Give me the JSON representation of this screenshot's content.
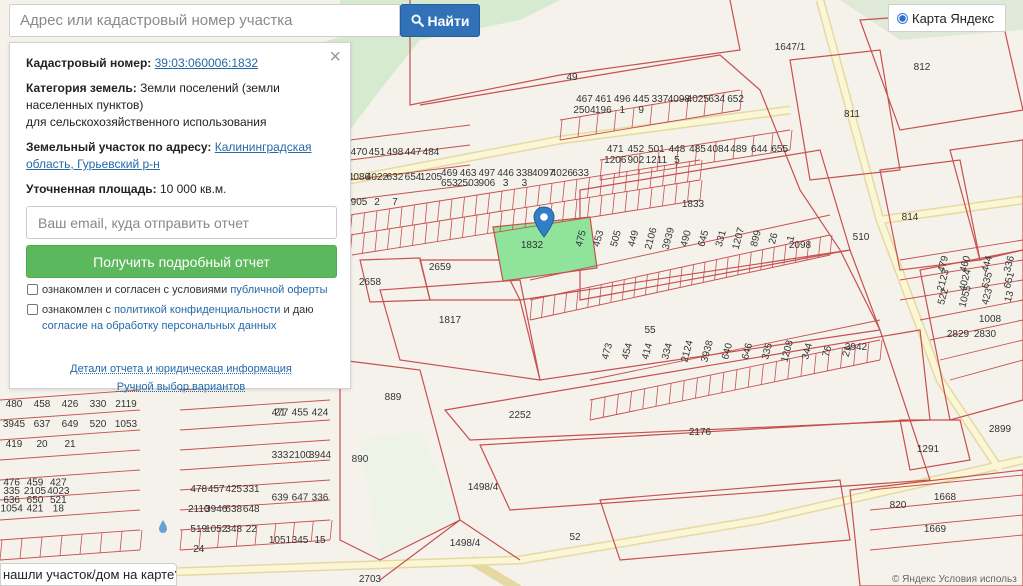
{
  "search": {
    "placeholder": "Адрес или кадастровый номер участка",
    "button_label": "Найти"
  },
  "layer_switch": {
    "label": "Карта Яндекс"
  },
  "info": {
    "cadastral_label": "Кадастровый номер:",
    "cadastral_value": "39:03:060006:1832",
    "category_label": "Категория земель:",
    "category_value_l1": "Земли поселений (земли",
    "category_value_l2": "населенных пунктов)",
    "category_value_l3": "для сельскохозяйственного использования",
    "address_label": "Земельный участок по адресу:",
    "address_value_l1": "Калининградская",
    "address_value_l2": "область, Гурьевский р-н",
    "area_label": "Уточненная площадь:",
    "area_value": "10 000 кв.м.",
    "email_placeholder": "Ваш email, куда отправить отчет",
    "get_report": "Получить подробный отчет",
    "consent1_text": "ознакомлен и согласен с условиями ",
    "consent1_link": "публичной оферты",
    "consent2_text_a": "ознакомлен с ",
    "consent2_link_a": "политикой конфиденциальности",
    "consent2_text_b": " и даю",
    "consent2_link_b": "согласие на обработку персональных данных",
    "details_link": "Детали отчета и юридическая информация",
    "manual_link": "Ручной выбор вариантов"
  },
  "bottom_question": "нашли участок/дом на карте?",
  "copyright": "© Яндекс  Условия использ",
  "colors": {
    "parcel_line": "#c65050",
    "selected": "#8fe39a",
    "road": "#fbf6d8",
    "green": "#d7ebd0",
    "water_blue": "#a5c6e6"
  },
  "map_labels": [
    "1832",
    "1833",
    "2659",
    "2658",
    "1817",
    "55",
    "2252",
    "2176",
    "889",
    "890",
    "49",
    "52",
    "812",
    "811",
    "814",
    "1291",
    "1668",
    "1669",
    "820",
    "1008",
    "2829",
    "2830",
    "2098",
    "3942",
    "1498/4",
    "1498/4",
    "510",
    "1647/1",
    "2899",
    "2703",
    "467",
    "469",
    "470",
    "471",
    "475",
    "473",
    "477",
    "478",
    "480",
    "476",
    "479",
    "461",
    "463",
    "451",
    "452",
    "453",
    "454",
    "455",
    "457",
    "458",
    "459",
    "460",
    "496",
    "497",
    "498",
    "501",
    "505",
    "414",
    "424",
    "425",
    "426",
    "427",
    "444",
    "445",
    "446",
    "447",
    "448",
    "449",
    "334",
    "333",
    "331",
    "330",
    "335",
    "336",
    "337",
    "338",
    "484",
    "485",
    "2106",
    "2124",
    "2100",
    "2110",
    "2119",
    "2105",
    "2123",
    "4098",
    "4097",
    "4086",
    "4084",
    "3939",
    "3938",
    "3944",
    "3946",
    "3945",
    "4023",
    "4024",
    "4025",
    "4026",
    "4022",
    "489",
    "490",
    "640",
    "639",
    "638",
    "637",
    "636",
    "635",
    "634",
    "633",
    "632",
    "644",
    "645",
    "646",
    "647",
    "648",
    "649",
    "650",
    "651",
    "652",
    "653",
    "654",
    "655",
    "331",
    "335",
    "336",
    "519",
    "520",
    "521",
    "522",
    "2504",
    "2503",
    "1205",
    "1206",
    "1207",
    "1208",
    "1051",
    "1052",
    "1053",
    "1054",
    "1055",
    "196",
    "906",
    "905",
    "902",
    "899",
    "344",
    "345",
    "348",
    "419",
    "421",
    "423",
    "1",
    "3",
    "2",
    "1211",
    "26",
    "76",
    "15",
    "22",
    "20",
    "18",
    "13",
    "9",
    "3",
    "7",
    "5",
    "1",
    "21",
    "21",
    "24",
    "21"
  ]
}
